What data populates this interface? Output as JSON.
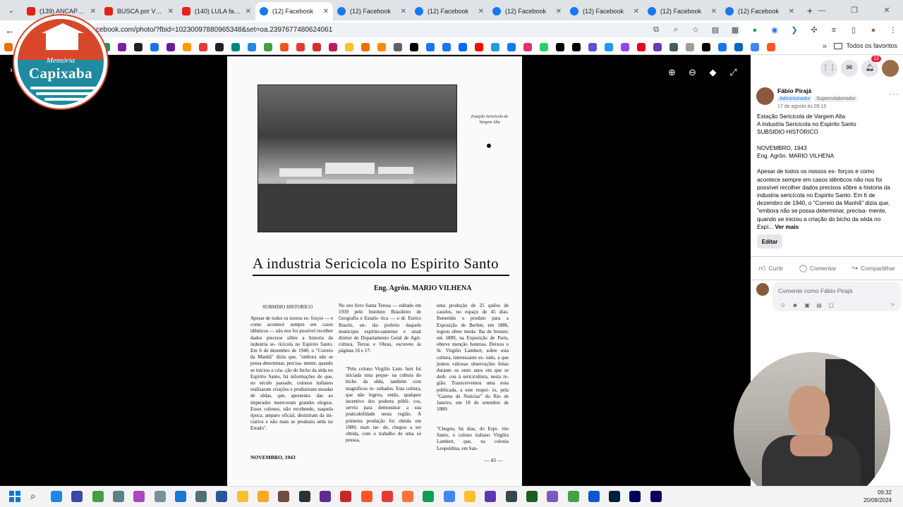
{
  "browser": {
    "tabs": [
      {
        "label": "(139) ANCAPSU -",
        "favicon": "youtube-icon",
        "active": false
      },
      {
        "label": "BUSCA por VPN n",
        "favicon": "youtube-icon",
        "active": false
      },
      {
        "label": "(140) LULA favore",
        "favicon": "youtube-icon",
        "active": false
      },
      {
        "label": "(12) Facebook",
        "favicon": "facebook-icon",
        "active": true
      },
      {
        "label": "(12) Facebook",
        "favicon": "facebook-icon",
        "active": false
      },
      {
        "label": "(12) Facebook",
        "favicon": "facebook-icon",
        "active": false
      },
      {
        "label": "(12) Facebook",
        "favicon": "facebook-icon",
        "active": false
      },
      {
        "label": "(12) Facebook",
        "favicon": "facebook-icon",
        "active": false
      },
      {
        "label": "(12) Facebook",
        "favicon": "facebook-icon",
        "active": false
      },
      {
        "label": "(12) Facebook",
        "favicon": "facebook-icon",
        "active": false
      }
    ],
    "url": "cebook.com/photo/?fbid=10230097880965348&set=oa.2397677480624061",
    "bookmarks_folder": "Todos os favoritos",
    "bookmark_colors": [
      "#e8710a",
      "#4285f4",
      "#0f9d58",
      "#5f6368",
      "#34a853",
      "#1a73e8",
      "#0f9d58",
      "#7b1fa2",
      "#202124",
      "#1a73e8",
      "#6a1b9a",
      "#ff9800",
      "#e53935",
      "#202124",
      "#00897b",
      "#1e88e5",
      "#43a047",
      "#f4511e",
      "#e53935",
      "#d32f2f",
      "#c2185b",
      "#fbc02d",
      "#ef6c00",
      "#fb8c00",
      "#5f6368",
      "#000000",
      "#1877f2",
      "#1877f2",
      "#0866ff",
      "#ff0000",
      "#229ed9",
      "#1877f2",
      "#e1306c",
      "#25d366",
      "#000000",
      "#000000",
      "#5b51d8",
      "#1d9bf0",
      "#9146ff",
      "#e60023",
      "#673ab7",
      "#455a64",
      "#9e9e9e",
      "#000000",
      "#1877f2",
      "#0a66c2",
      "#4285f4",
      "#ff5722"
    ]
  },
  "logo": {
    "small_text": "Memória",
    "big_text": "Capixaba"
  },
  "scan": {
    "caption": "Estação Sericícola de Vargem Alta",
    "headline": "A industria Sericicola no Espirito Santo",
    "author": "Eng. Agrôn. MARIO VILHENA",
    "col1_heading": "SUBSIDIO HISTORICO",
    "col1_text": "Apesar de todos os nossos es- forços — e como acontece sempre em casos idênticos — não nos foi possível recolher dados precisos sôbre a historia da industria se- ricícola no Espirito Santo. Em 6 de dezembro de 1940, o \"Correio da Manhã\" dizia que, \"embora não se possa determinar, precisa- mente, quando se iniciou a cria- ção do bicho da séda no Espirito Santo, há informações de que, no século passado, colonos italianos realizaram criações e produziram meadas de sêdas, que, apresenta- das ao imperador mereceram grandes elogios. Esses colonos, não recebendo, naquela época, amparo oficial, desistiram da ini- ciativa e não mais se produziu séda no Estado\".",
    "col2_text_a": "No seu livro Santa Teresa — editado em 1939 pelo Instituto Brasileiro de Geografia e Estatís- tica — o dr. Eurico Ruschi, en- tão prefeito daquele municipio espirito-santense e atual diretor do Departamento Geral de Agri- cultura, Terras e Obras, escreveu às páginas 16 e 17:",
    "col2_text_b": "\"Pelo colono Virgilio Lam- bert foi iniciada uma peque- na cultura do bicho da sêda, também com magnificos re- sultados. Esta cultura, que não logrou, então, qualquer incentivo dos poderes públi- cos, serviu para demonstrar a sua praticabilidade nesta região. A primeira produção foi obtida em 1880; mais tar- de, chegou a ser obtida, com o trabalho de uma só pessoa,",
    "col3_text_a": "uma produção de 25 quilos de casulos, no espaço de 45 dias. Remetido o produto para a Exposição de Berlim, em 1886, logrou obter meda- lha de bronze; em 1889, na Exposição de Paris, obteve menção honrosa. Deixou o Sr. Virgilio Lambert, sobre esta cultura, interessante es- tudo, a que juntou valiosas observações feitas durante os onze anos em que se dedi- cou à sericicultura, nesta re- gião. Transcrevemos uma nota publicada, a este respei- to, pela \"Gazeta de Noticias\" do Rio de Janeiro, em 18 de setembro de 1880:",
    "col3_text_b": "\"Chegou, há dias, do Espi- rito Santo, o colono italiano Virgilio Lambert, que, na colonia Leopoldina, em San-",
    "footer_date": "NOVEMBRO, 1943",
    "page_number": "— 43 —"
  },
  "facebook": {
    "notification_count": "12",
    "post": {
      "author": "Fábio Pirajá",
      "role_admin": "Administrador",
      "role_super": "Supercolaborador",
      "time": "17 de agosto às 09:15",
      "lines": [
        "Estação Sericicola de Vargem Alta",
        "A industria Sericicola no Espirito Santo",
        "SUBSIDIO HISTÓRICO",
        "",
        "NOVEMBRO, 1943",
        "Eng. Agrôn. MARIO VILHENA",
        "",
        "Apesar de todos os nossos es- forços e como acontece sempre em casos idênticos não nos foi possível recolher dados precisos sôbre a historia da industria sericícola no Espirito Santo. Em 6 de dezembro de 1940, o \"Correio da Manhã\" dizia que, \"embora não se possa determinar, precisa- mente, quando se iniciou a criação do bicho da séda no Espí..."
      ],
      "see_more": "Ver mais",
      "edit_label": "Editar"
    },
    "actions": {
      "like": "Curtir",
      "comment": "Comentar",
      "share": "Compartilhar"
    },
    "comment_placeholder": "Comente como Fábio Pirajá"
  },
  "taskbar": {
    "time": "09:32",
    "date": "20/08/2024",
    "apps": [
      "#1e88e5",
      "#3949ab",
      "#43a047",
      "#607d8b",
      "#ab47bc",
      "#78909c",
      "#1976d2",
      "#546e7a",
      "#2b579a",
      "#fbc02d",
      "#f9a825",
      "#6d4c41",
      "#263238",
      "#5c2d91",
      "#c62828",
      "#fb542b",
      "#e53935",
      "#ff7139",
      "#0f9d58",
      "#4285f4",
      "#fbc02d",
      "#5e35b1",
      "#37474f",
      "#1b5e20",
      "#7e57c2",
      "#43a047",
      "#0b57d0",
      "#001e36",
      "#00005b",
      "#00005b"
    ]
  }
}
